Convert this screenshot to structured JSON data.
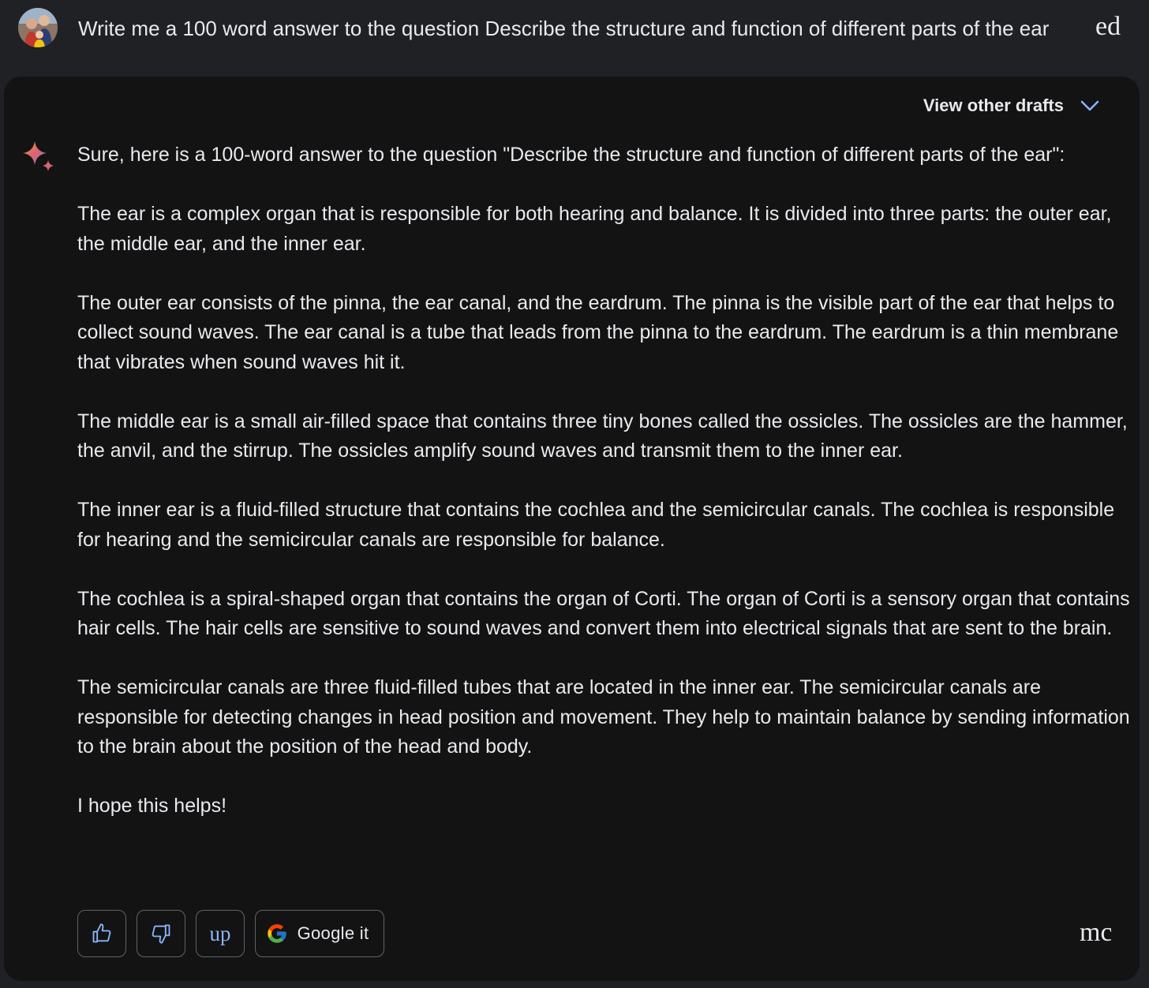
{
  "prompt": {
    "text": "Write me a 100 word answer to the question Describe the structure and function of different parts of the ear",
    "edit_label": "ed"
  },
  "response": {
    "drafts_label": "View other drafts",
    "paragraphs": [
      "Sure, here is a 100-word answer to the question \"Describe the structure and function of different parts of the ear\":",
      "The ear is a complex organ that is responsible for both hearing and balance. It is divided into three parts: the outer ear, the middle ear, and the inner ear.",
      "The outer ear consists of the pinna, the ear canal, and the eardrum. The pinna is the visible part of the ear that helps to collect sound waves. The ear canal is a tube that leads from the pinna to the eardrum. The eardrum is a thin membrane that vibrates when sound waves hit it.",
      "The middle ear is a small air-filled space that contains three tiny bones called the ossicles. The ossicles are the hammer, the anvil, and the stirrup. The ossicles amplify sound waves and transmit them to the inner ear.",
      "The inner ear is a fluid-filled structure that contains the cochlea and the semicircular canals. The cochlea is responsible for hearing and the semicircular canals are responsible for balance.",
      "The cochlea is a spiral-shaped organ that contains the organ of Corti. The organ of Corti is a sensory organ that contains hair cells. The hair cells are sensitive to sound waves and convert them into electrical signals that are sent to the brain.",
      "The semicircular canals are three fluid-filled tubes that are located in the inner ear. The semicircular canals are responsible for detecting changes in head position and movement. They help to maintain balance by sending information to the brain about the position of the head and body.",
      "I hope this helps!"
    ]
  },
  "actions": {
    "thumbs_up_icon": "thumbs-up-icon",
    "thumbs_down_icon": "thumbs-down-icon",
    "up_label": "up",
    "google_label": "Google it",
    "more_label": "mc"
  },
  "colors": {
    "page_bg": "#202124",
    "card_bg": "#131314",
    "text": "#e8eaed",
    "accent_blue": "#8ab4f8",
    "border": "#5f6368"
  }
}
